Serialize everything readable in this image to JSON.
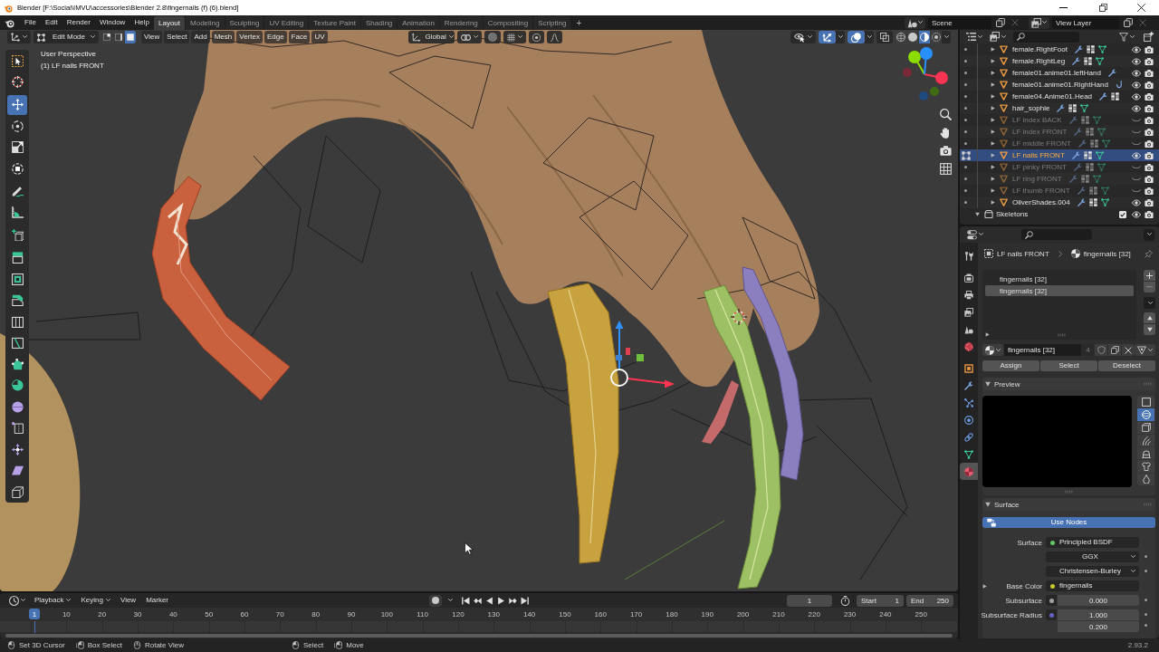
{
  "window": {
    "title": "Blender [F:\\Social\\IMVU\\accessories\\Blender 2.8\\fingernails (f) (6).blend]"
  },
  "top_bar": {
    "menus": [
      "File",
      "Edit",
      "Render",
      "Window",
      "Help"
    ],
    "workspaces": [
      {
        "label": "Layout",
        "selected": true
      },
      {
        "label": "Modeling",
        "selected": false
      },
      {
        "label": "Sculpting",
        "selected": false
      },
      {
        "label": "UV Editing",
        "selected": false
      },
      {
        "label": "Texture Paint",
        "selected": false
      },
      {
        "label": "Shading",
        "selected": false
      },
      {
        "label": "Animation",
        "selected": false
      },
      {
        "label": "Rendering",
        "selected": false
      },
      {
        "label": "Compositing",
        "selected": false
      },
      {
        "label": "Scripting",
        "selected": false
      }
    ],
    "add_workspace": "+",
    "scene": "Scene",
    "view_layer": "View Layer"
  },
  "viewport": {
    "header": {
      "mode": "Edit Mode",
      "select_modes": [
        {
          "kind": "vertex",
          "selected": false
        },
        {
          "kind": "edge",
          "selected": false
        },
        {
          "kind": "face",
          "selected": true
        }
      ],
      "menus": [
        "View",
        "Select",
        "Add",
        "Mesh",
        "Vertex",
        "Edge",
        "Face",
        "UV"
      ],
      "orientation": "Global",
      "snap": false,
      "proportional_editing": false,
      "gizmos": true,
      "overlays": true,
      "xray": false,
      "shading": [
        {
          "kind": "wireframe",
          "selected": false
        },
        {
          "kind": "solid",
          "selected": false
        },
        {
          "kind": "material",
          "selected": true
        },
        {
          "kind": "rendered",
          "selected": false
        }
      ]
    },
    "overlay_text": [
      "User Perspective",
      "(1) LF nails FRONT"
    ],
    "tool_groups": [
      {
        "tools": [
          {
            "kind": "select_box",
            "selected": false
          },
          {
            "kind": "cursor",
            "selected": false
          }
        ]
      },
      {
        "tools": [
          {
            "kind": "move",
            "selected": true
          },
          {
            "kind": "rotate",
            "selected": false
          },
          {
            "kind": "scale",
            "selected": false
          },
          {
            "kind": "transform",
            "selected": false
          }
        ]
      },
      {
        "tools": [
          {
            "kind": "annotate",
            "selected": false
          },
          {
            "kind": "measure",
            "selected": false
          }
        ]
      },
      {
        "tools": [
          {
            "kind": "add_cube",
            "selected": false
          }
        ]
      },
      {
        "tools": [
          {
            "kind": "extrude",
            "selected": false
          },
          {
            "kind": "inset",
            "selected": false
          },
          {
            "kind": "bevel",
            "selected": false
          },
          {
            "kind": "loop_cut",
            "selected": false
          },
          {
            "kind": "knife",
            "selected": false
          },
          {
            "kind": "poly_build",
            "selected": false
          },
          {
            "kind": "spin",
            "selected": false
          },
          {
            "kind": "smooth",
            "selected": false
          },
          {
            "kind": "edge_slide",
            "selected": false
          },
          {
            "kind": "shrink_fatten",
            "selected": false
          },
          {
            "kind": "shear",
            "selected": false
          },
          {
            "kind": "rip",
            "selected": false
          }
        ]
      }
    ]
  },
  "outliner": {
    "rows": [
      {
        "kind": "object",
        "name": "female.RightFoot",
        "expanded": false,
        "selected": false,
        "visible": true,
        "badges": [
          {
            "kind": "modifier"
          },
          {
            "kind": "vertex_groups"
          },
          {
            "kind": "mesh"
          }
        ]
      },
      {
        "kind": "object",
        "name": "female.RightLeg",
        "expanded": false,
        "selected": false,
        "visible": true,
        "badges": [
          {
            "kind": "modifier"
          },
          {
            "kind": "vertex_groups"
          },
          {
            "kind": "mesh"
          }
        ]
      },
      {
        "kind": "object",
        "name": "female01.anime01.leftHand",
        "expanded": false,
        "selected": false,
        "visible": true,
        "badges": [
          {
            "kind": "modifier"
          }
        ]
      },
      {
        "kind": "object",
        "name": "female01.anime01.RightHand",
        "expanded": false,
        "selected": false,
        "visible": true,
        "badges": [
          {
            "kind": "hook"
          }
        ]
      },
      {
        "kind": "object",
        "name": "female04.Anime01.Head",
        "expanded": false,
        "selected": false,
        "visible": true,
        "badges": [
          {
            "kind": "modifier"
          },
          {
            "kind": "vertex_groups"
          }
        ]
      },
      {
        "kind": "object",
        "name": "hair_sophie",
        "expanded": false,
        "selected": false,
        "visible": true,
        "badges": [
          {
            "kind": "modifier"
          },
          {
            "kind": "vertex_groups"
          },
          {
            "kind": "mesh"
          }
        ]
      },
      {
        "kind": "object",
        "name": "LF index BACK",
        "expanded": false,
        "selected": false,
        "visible": false,
        "badges": [
          {
            "kind": "modifier"
          },
          {
            "kind": "vertex_groups"
          },
          {
            "kind": "mesh"
          }
        ]
      },
      {
        "kind": "object",
        "name": "LF index FRONT",
        "expanded": false,
        "selected": false,
        "visible": false,
        "badges": [
          {
            "kind": "modifier"
          },
          {
            "kind": "vertex_groups"
          },
          {
            "kind": "mesh"
          }
        ]
      },
      {
        "kind": "object",
        "name": "LF middle FRONT",
        "expanded": false,
        "selected": false,
        "visible": false,
        "badges": [
          {
            "kind": "modifier"
          },
          {
            "kind": "vertex_groups"
          },
          {
            "kind": "mesh"
          }
        ]
      },
      {
        "kind": "object",
        "name": "LF nails FRONT",
        "expanded": false,
        "selected": true,
        "visible": true,
        "badges": [
          {
            "kind": "modifier"
          },
          {
            "kind": "vertex_groups"
          },
          {
            "kind": "mesh"
          }
        ]
      },
      {
        "kind": "object",
        "name": "LF pinky FRONT",
        "expanded": false,
        "selected": false,
        "visible": false,
        "badges": [
          {
            "kind": "modifier"
          },
          {
            "kind": "vertex_groups"
          },
          {
            "kind": "mesh"
          }
        ]
      },
      {
        "kind": "object",
        "name": "LF ring FRONT",
        "expanded": false,
        "selected": false,
        "visible": false,
        "badges": [
          {
            "kind": "modifier"
          },
          {
            "kind": "vertex_groups"
          },
          {
            "kind": "mesh"
          }
        ]
      },
      {
        "kind": "object",
        "name": "LF thumb FRONT",
        "expanded": false,
        "selected": false,
        "visible": false,
        "badges": [
          {
            "kind": "modifier"
          },
          {
            "kind": "vertex_groups"
          },
          {
            "kind": "mesh"
          }
        ]
      },
      {
        "kind": "object",
        "name": "OliverShades.004",
        "expanded": false,
        "selected": false,
        "visible": true,
        "badges": [
          {
            "kind": "modifier"
          },
          {
            "kind": "vertex_groups"
          },
          {
            "kind": "mesh"
          }
        ]
      },
      {
        "kind": "collection",
        "name": "Skeletons",
        "expanded": true,
        "selected": false,
        "visible": true,
        "checked": true
      }
    ]
  },
  "properties": {
    "tab_groups": [
      {
        "tabs": [
          {
            "kind": "tool",
            "selected": false
          }
        ]
      },
      {
        "tabs": [
          {
            "kind": "render",
            "selected": false
          },
          {
            "kind": "output",
            "selected": false
          },
          {
            "kind": "view_layer",
            "selected": false
          },
          {
            "kind": "scene",
            "selected": false
          },
          {
            "kind": "world",
            "selected": false
          }
        ]
      },
      {
        "tabs": [
          {
            "kind": "object",
            "selected": false
          },
          {
            "kind": "modifiers",
            "selected": false
          },
          {
            "kind": "particles",
            "selected": false
          },
          {
            "kind": "physics",
            "selected": false
          },
          {
            "kind": "constraints",
            "selected": false
          },
          {
            "kind": "data",
            "selected": false
          },
          {
            "kind": "material",
            "selected": true
          }
        ]
      }
    ],
    "breadcrumb": {
      "object": "LF nails FRONT",
      "material": "fingernails [32]"
    },
    "slots": [
      {
        "label": "fingernails [32]",
        "selected": false
      },
      {
        "label": "fingernails [32]",
        "selected": true
      }
    ],
    "material": {
      "name": "fingernails [32]",
      "users": "4"
    },
    "slot_actions": [
      "Assign",
      "Select",
      "Deselect"
    ],
    "preview": {
      "title": "Preview",
      "expanded": true,
      "shapes": [
        {
          "kind": "plane",
          "selected": false
        },
        {
          "kind": "sphere",
          "selected": true
        },
        {
          "kind": "cube",
          "selected": false
        },
        {
          "kind": "hair",
          "selected": false
        },
        {
          "kind": "shader_ball",
          "selected": false
        },
        {
          "kind": "cloth",
          "selected": false
        },
        {
          "kind": "fluid",
          "selected": false
        }
      ]
    },
    "surface": {
      "title": "Surface",
      "expanded": true,
      "use_nodes": {
        "label": "Use Nodes",
        "on": true
      },
      "rows": [
        {
          "kind": "link",
          "label": "Surface",
          "value": "Principled BSDF",
          "color": "#63c763"
        },
        {
          "kind": "enum",
          "value": "GGX"
        },
        {
          "kind": "enum",
          "value": "Christensen-Burley"
        },
        {
          "kind": "link",
          "label": "Base Color",
          "value": "fingernails",
          "color": "#c7c729",
          "expanded": false
        },
        {
          "kind": "number",
          "label": "Subsurface",
          "value": "0.000",
          "color": "#a1a1a1"
        },
        {
          "kind": "vector",
          "label": "Subsurface Radius",
          "values": [
            "1.000",
            "0.200"
          ],
          "color": "#6363c7"
        }
      ]
    }
  },
  "timeline": {
    "menus": [
      {
        "label": "Playback",
        "dropdown": true
      },
      {
        "label": "Keying",
        "dropdown": true
      },
      {
        "label": "View",
        "dropdown": false
      },
      {
        "label": "Marker",
        "dropdown": false
      }
    ],
    "auto_keying": false,
    "current_frame": "1",
    "start": {
      "label": "Start",
      "value": "1"
    },
    "end": {
      "label": "End",
      "value": "250"
    },
    "playhead": "1",
    "ruler": [
      "10",
      "20",
      "30",
      "40",
      "50",
      "60",
      "70",
      "80",
      "90",
      "100",
      "110",
      "120",
      "130",
      "140",
      "150",
      "160",
      "170",
      "180",
      "190",
      "200",
      "210",
      "220",
      "230",
      "240",
      "250"
    ]
  },
  "status_bar": {
    "hint_groups": [
      {
        "hints": [
          {
            "kind": "mouse_left",
            "label": "Set 3D Cursor"
          },
          {
            "kind": "mouse_drag",
            "label": "Box Select"
          },
          {
            "kind": "mouse_middle",
            "label": "Rotate View"
          }
        ]
      },
      {
        "hints": [
          {
            "kind": "mouse_left",
            "label": "Select"
          },
          {
            "kind": "mouse_drag",
            "label": "Move"
          }
        ]
      }
    ],
    "version": "2.93.2"
  }
}
